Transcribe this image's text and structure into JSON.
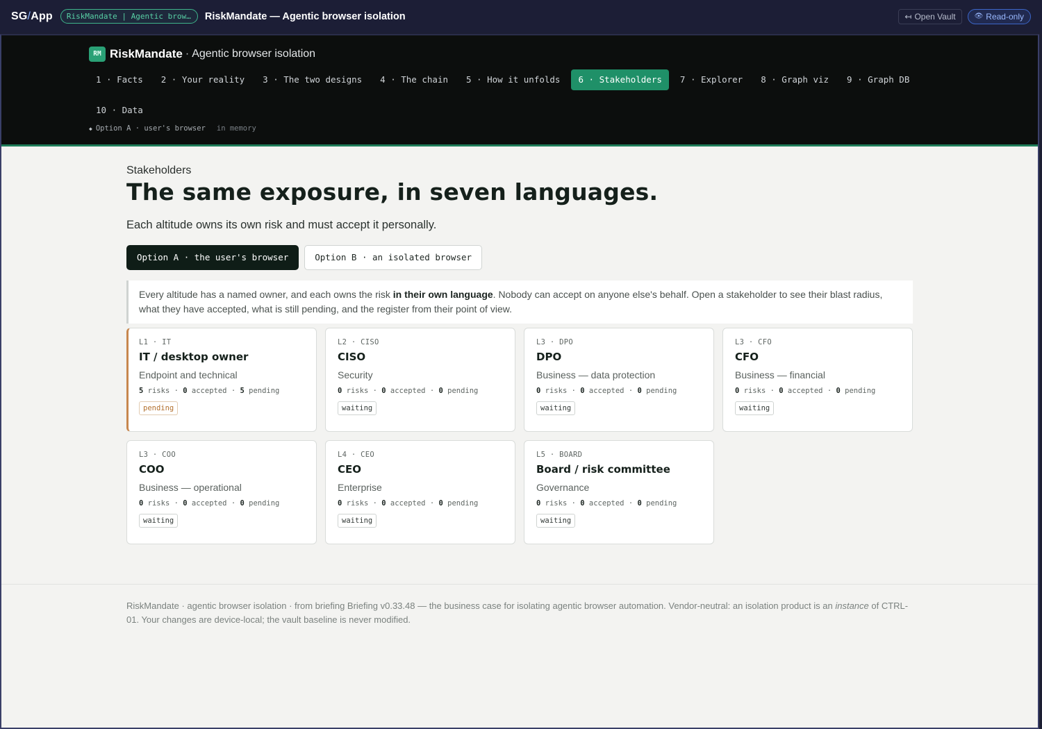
{
  "app": {
    "brand_left": "SG",
    "brand_slash": "/",
    "brand_right": "App",
    "vault_pill": "RiskMandate | Agentic browser isolation",
    "window_title": "RiskMandate — Agentic browser isolation",
    "open_vault_icon": "↤",
    "open_vault_label": "Open Vault",
    "read_only_icon": "👁",
    "read_only_label": "Read-only",
    "colors": {
      "accent": "#1f9068",
      "appbar": "#1c1e36",
      "pending": "#c7864e",
      "link": "#3c66c8"
    }
  },
  "header": {
    "badge": "RM",
    "app_name": "RiskMandate",
    "separator": "·",
    "subtitle": "Agentic browser isolation",
    "tabs": [
      {
        "label": "1 · Facts",
        "active": false
      },
      {
        "label": "2 · Your reality",
        "active": false
      },
      {
        "label": "3 · The two designs",
        "active": false
      },
      {
        "label": "4 · The chain",
        "active": false
      },
      {
        "label": "5 · How it unfolds",
        "active": false
      },
      {
        "label": "6 · Stakeholders",
        "active": true
      },
      {
        "label": "7 · Explorer",
        "active": false
      },
      {
        "label": "8 · Graph viz",
        "active": false
      },
      {
        "label": "9 · Graph DB",
        "active": false
      },
      {
        "label": "10 · Data",
        "active": false
      }
    ],
    "status_dot": "◆",
    "status_text": "Option A · user's browser",
    "status_mem": "in memory"
  },
  "main": {
    "eyebrow": "Stakeholders",
    "headline": "The same exposure, in seven languages.",
    "lede": "Each altitude owns its own risk and must accept it personally.",
    "options": [
      {
        "label": "Option A · the user's browser",
        "active": true
      },
      {
        "label": "Option B · an isolated browser",
        "active": false
      }
    ],
    "callout": {
      "before": "Every altitude has a named owner, and each owns the risk ",
      "bold": "in their own language",
      "after": ". Nobody can accept on anyone else's behalf. Open a stakeholder to see their blast radius, what they have accepted, what is still pending, and the register from their point of view."
    },
    "cards": [
      {
        "code": "L1 · IT",
        "title": "IT / desktop owner",
        "sub": "Endpoint and technical",
        "risks": "5",
        "accepted": "0",
        "pending": "5",
        "badge": "pending"
      },
      {
        "code": "L2 · CISO",
        "title": "CISO",
        "sub": "Security",
        "risks": "0",
        "accepted": "0",
        "pending": "0",
        "badge": "waiting"
      },
      {
        "code": "L3 · DPO",
        "title": "DPO",
        "sub": "Business — data protection",
        "risks": "0",
        "accepted": "0",
        "pending": "0",
        "badge": "waiting"
      },
      {
        "code": "L3 · CFO",
        "title": "CFO",
        "sub": "Business — financial",
        "risks": "0",
        "accepted": "0",
        "pending": "0",
        "badge": "waiting"
      },
      {
        "code": "L3 · COO",
        "title": "COO",
        "sub": "Business — operational",
        "risks": "0",
        "accepted": "0",
        "pending": "0",
        "badge": "waiting"
      },
      {
        "code": "L4 · CEO",
        "title": "CEO",
        "sub": "Enterprise",
        "risks": "0",
        "accepted": "0",
        "pending": "0",
        "badge": "waiting"
      },
      {
        "code": "L5 · BOARD",
        "title": "Board / risk committee",
        "sub": "Governance",
        "risks": "0",
        "accepted": "0",
        "pending": "0",
        "badge": "waiting"
      }
    ],
    "stat_words": {
      "risks": "risks",
      "accepted": "accepted",
      "pending": "pending",
      "sep": "·"
    }
  },
  "footer": {
    "line1": "RiskMandate · agentic browser isolation · from briefing Briefing v0.33.48 — the business case for isolating agentic browser automation. Vendor-neutral: an isolation product is an",
    "italic": "instance",
    "line2": " of CTRL-01. Your changes are device-local; the vault baseline is never modified."
  }
}
